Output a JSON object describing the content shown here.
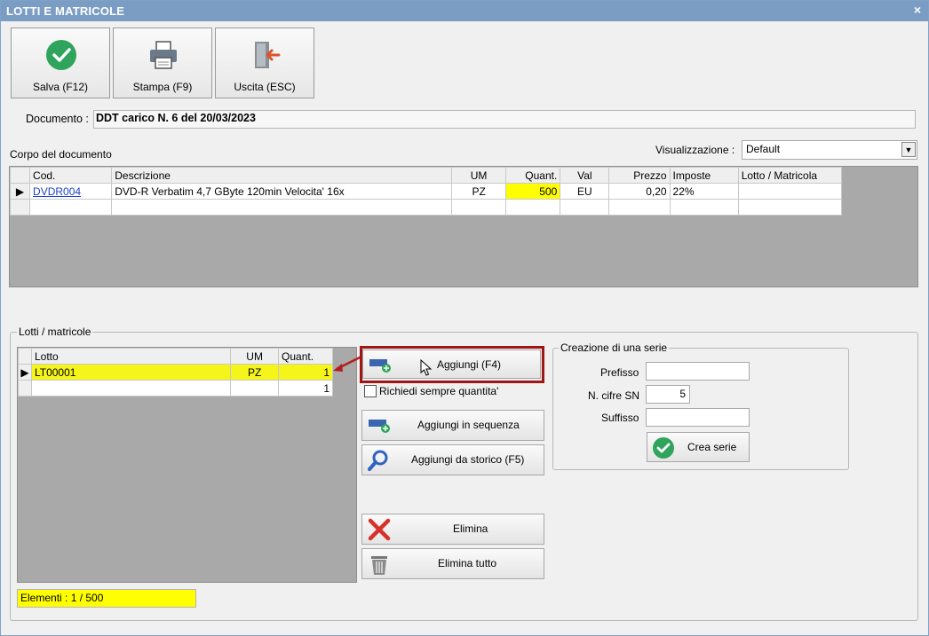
{
  "window": {
    "title": "LOTTI E MATRICOLE",
    "close_glyph": "×"
  },
  "toolbar": {
    "save_label": "Salva (F12)",
    "print_label": "Stampa (F9)",
    "exit_label": "Uscita (ESC)",
    "save_icon": "check-circle-icon",
    "print_icon": "printer-icon",
    "exit_icon": "exit-door-icon"
  },
  "documento": {
    "label": "Documento :",
    "value": "DDT carico N. 6 del 20/03/2023"
  },
  "corpo": {
    "label": "Corpo del documento",
    "visualizzazione_label": "Visualizzazione :",
    "visualizzazione_value": "Default",
    "columns": [
      "Cod.",
      "Descrizione",
      "UM",
      "Quant.",
      "Val",
      "Prezzo",
      "Imposte",
      "Lotto / Matricola"
    ],
    "rows": [
      {
        "cod": "DVDR004",
        "descrizione": "DVD-R Verbatim 4,7 GByte 120min  Velocita' 16x",
        "um": "PZ",
        "quant": "500",
        "val": "EU",
        "prezzo": "0,20",
        "imposte": "22%",
        "lotto": ""
      }
    ]
  },
  "lotti": {
    "group_label": "Lotti / matricole",
    "columns": [
      "Lotto",
      "UM",
      "Quant."
    ],
    "rows": [
      {
        "lotto": "LT00001",
        "um": "PZ",
        "quant": "1"
      },
      {
        "lotto": "",
        "um": "",
        "quant": "1"
      }
    ],
    "elementi": "Elementi : 1 / 500"
  },
  "actions": {
    "aggiungi": "Aggiungi (F4)",
    "richiedi": "Richiedi sempre quantita'",
    "aggiungi_sequenza": "Aggiungi in sequenza",
    "aggiungi_storico": "Aggiungi da storico (F5)",
    "elimina": "Elimina",
    "elimina_tutto": "Elimina tutto"
  },
  "serie": {
    "group_label": "Creazione di una serie",
    "prefisso_label": "Prefisso",
    "prefisso_value": "",
    "cifre_label": "N. cifre SN",
    "cifre_value": "5",
    "suffisso_label": "Suffisso",
    "suffisso_value": "",
    "crea_label": "Crea serie"
  },
  "colors": {
    "titlebar": "#7b9dc4",
    "highlight": "#ffff00",
    "selected_row": "#f5f51a",
    "grid_bg": "#a9a9a9",
    "callout": "#a01515"
  }
}
